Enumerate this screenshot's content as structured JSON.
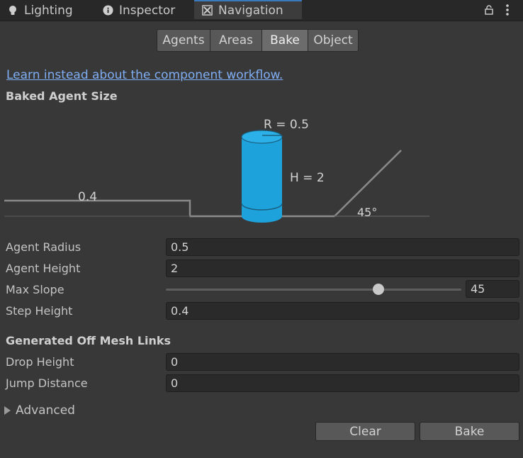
{
  "tabs": [
    {
      "label": "Lighting",
      "icon": "lightbulb-icon"
    },
    {
      "label": "Inspector",
      "icon": "info-icon"
    },
    {
      "label": "Navigation",
      "icon": "navigation-icon",
      "active": true
    }
  ],
  "segments": [
    "Agents",
    "Areas",
    "Bake",
    "Object"
  ],
  "active_segment": "Bake",
  "link_text": "Learn instead about the component workflow.",
  "baked_agent_size": {
    "title": "Baked Agent Size",
    "radius_label": "R = 0.5",
    "height_label": "H = 2",
    "step_label": "0.4",
    "slope_label": "45°"
  },
  "fields": {
    "agent_radius": {
      "label": "Agent Radius",
      "value": "0.5"
    },
    "agent_height": {
      "label": "Agent Height",
      "value": "2"
    },
    "max_slope": {
      "label": "Max Slope",
      "value": "45",
      "slider_fraction": 0.72
    },
    "step_height": {
      "label": "Step Height",
      "value": "0.4"
    }
  },
  "off_mesh": {
    "title": "Generated Off Mesh Links",
    "drop_height": {
      "label": "Drop Height",
      "value": "0"
    },
    "jump_distance": {
      "label": "Jump Distance",
      "value": "0"
    }
  },
  "advanced_label": "Advanced",
  "buttons": {
    "clear": "Clear",
    "bake": "Bake"
  },
  "colors": {
    "accent": "#3a79bb",
    "link": "#7faef4",
    "agent": "#1ea2dc"
  }
}
